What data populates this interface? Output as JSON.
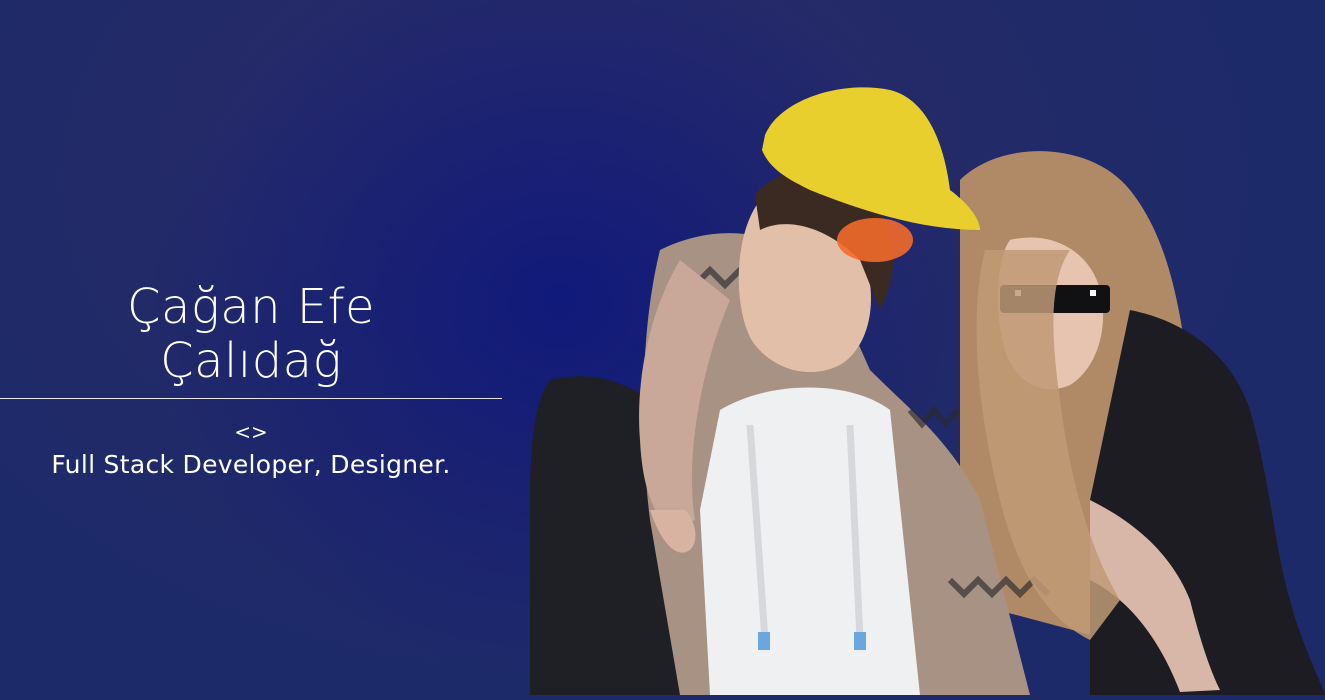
{
  "hero": {
    "name_line1": "Çağan Efe",
    "name_line2": "Çalıdağ",
    "code_symbol": "<>",
    "role": "Full Stack Developer, Designer."
  },
  "colors": {
    "background": "#232a68",
    "accent_glow": "#101a7a",
    "text": "#ffffff"
  }
}
